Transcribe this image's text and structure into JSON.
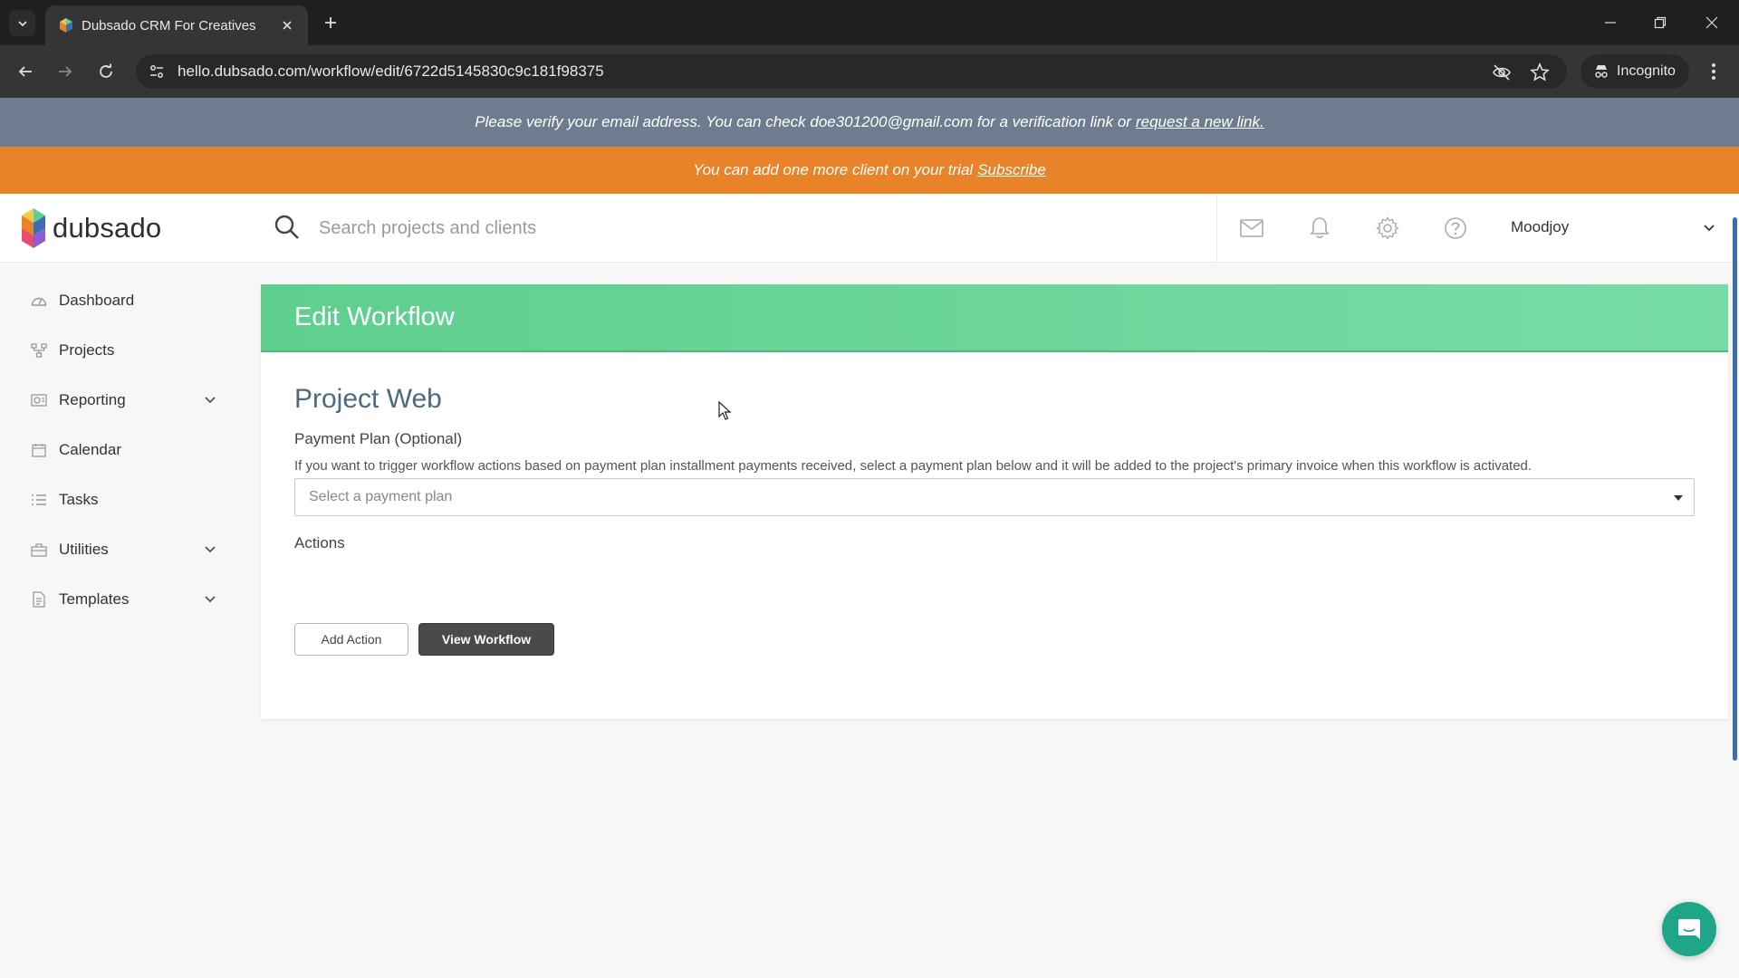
{
  "browser": {
    "tab_title": "Dubsado CRM For Creatives",
    "url": "hello.dubsado.com/workflow/edit/6722d5145830c9c181f98375",
    "incognito_label": "Incognito"
  },
  "banners": {
    "verify_text": "Please verify your email address. You can check doe301200@gmail.com for a verification link or",
    "verify_link": "request a new link.",
    "trial_text": "You can add one more client on your trial",
    "trial_link": "Subscribe"
  },
  "header": {
    "logo_text": "dubsado",
    "search_placeholder": "Search projects and clients",
    "user_name": "Moodjoy"
  },
  "sidebar": {
    "items": [
      {
        "label": "Dashboard",
        "icon": "dashboard-icon"
      },
      {
        "label": "Projects",
        "icon": "projects-icon"
      },
      {
        "label": "Reporting",
        "icon": "reporting-icon",
        "expandable": true
      },
      {
        "label": "Calendar",
        "icon": "calendar-icon"
      },
      {
        "label": "Tasks",
        "icon": "tasks-icon"
      },
      {
        "label": "Utilities",
        "icon": "utilities-icon",
        "expandable": true
      },
      {
        "label": "Templates",
        "icon": "templates-icon",
        "expandable": true
      }
    ]
  },
  "main": {
    "page_title": "Edit Workflow",
    "workflow_name": "Project Web",
    "payment_plan_label": "Payment Plan (Optional)",
    "payment_plan_help": "If you want to trigger workflow actions based on payment plan installment payments received, select a payment plan below and it will be added to the project's primary invoice when this workflow is activated.",
    "payment_plan_placeholder": "Select a payment plan",
    "actions_label": "Actions",
    "add_action_label": "Add Action",
    "view_workflow_label": "View Workflow"
  },
  "colors": {
    "header_green": "#5ecf8e",
    "verify_banner": "#6d7c8e",
    "trial_banner": "#e8832a",
    "chat_button": "#1fa689"
  }
}
